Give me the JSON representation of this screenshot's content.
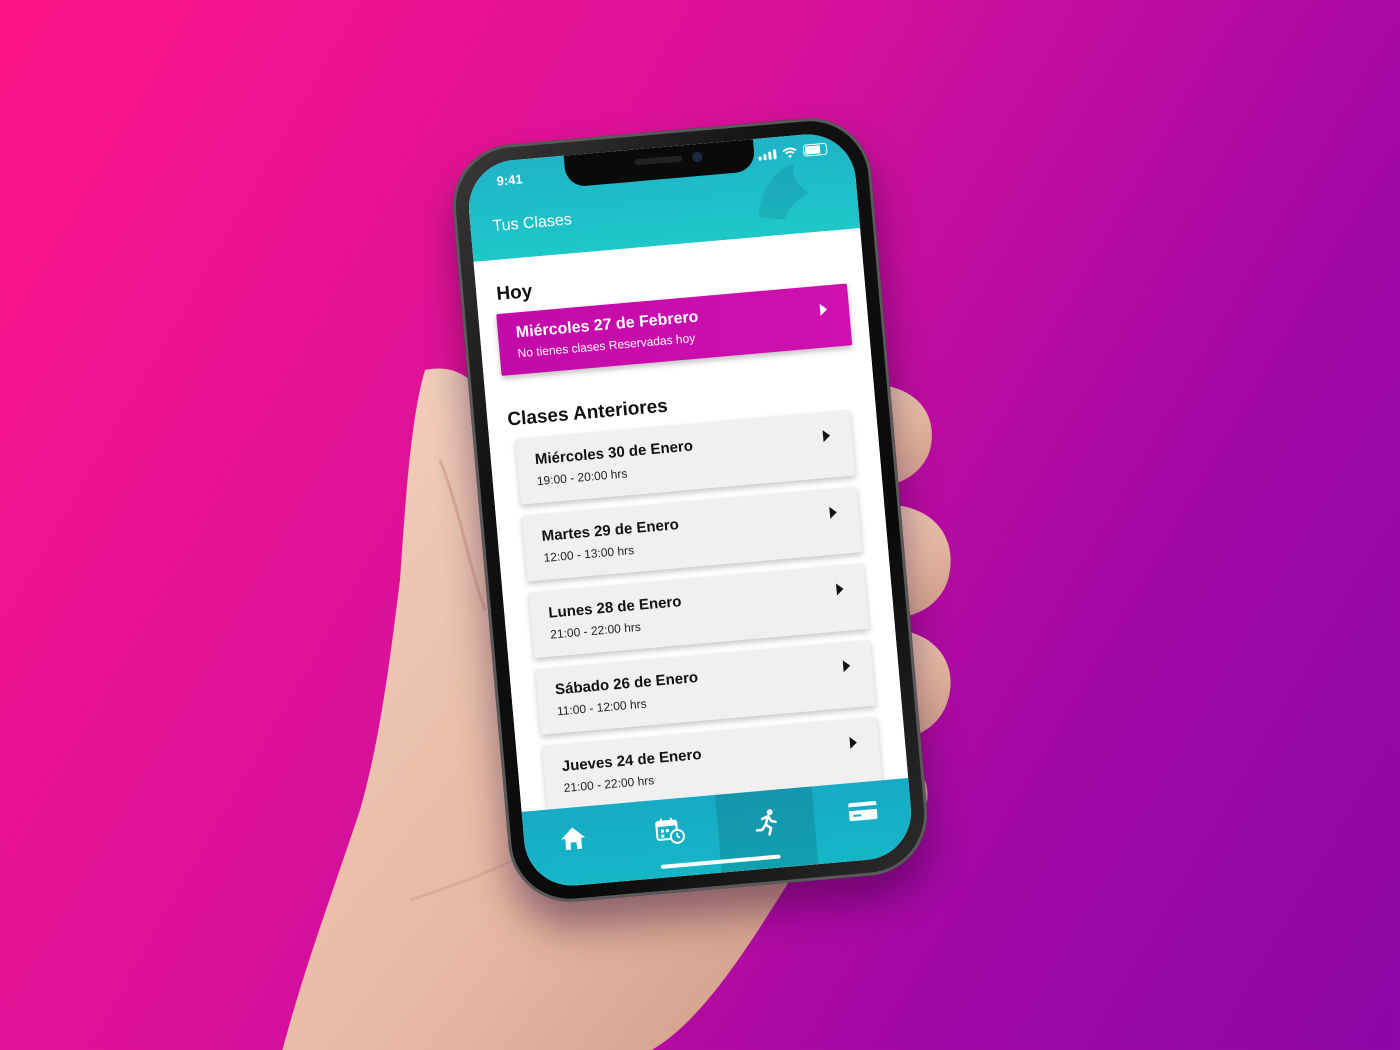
{
  "status_bar": {
    "time": "9:41"
  },
  "header": {
    "title": "Tus Clases"
  },
  "today": {
    "section_title": "Hoy",
    "date": "Miércoles 27 de Febrero",
    "message": "No tienes clases Reservadas hoy"
  },
  "past": {
    "section_title": "Clases Anteriores",
    "classes": [
      {
        "date": "Miércoles 30 de Enero",
        "time": "19:00 - 20:00 hrs"
      },
      {
        "date": "Martes 29 de Enero",
        "time": "12:00 - 13:00 hrs"
      },
      {
        "date": "Lunes 28 de Enero",
        "time": "21:00 - 22:00 hrs"
      },
      {
        "date": "Sábado 26 de Enero",
        "time": "11:00 - 12:00 hrs"
      },
      {
        "date": "Jueves 24 de Enero",
        "time": "21:00 - 22:00 hrs"
      }
    ]
  },
  "bottom_nav": {
    "items": [
      {
        "icon": "home-icon",
        "active": false
      },
      {
        "icon": "calendar-clock-icon",
        "active": false
      },
      {
        "icon": "running-icon",
        "active": true
      },
      {
        "icon": "card-icon",
        "active": false
      }
    ]
  },
  "colors": {
    "background_start": "#ff1488",
    "background_end": "#8d07a6",
    "header_accent": "#1fb3c8",
    "today_card": "#c20aa8",
    "class_card": "#f0f0f0"
  }
}
